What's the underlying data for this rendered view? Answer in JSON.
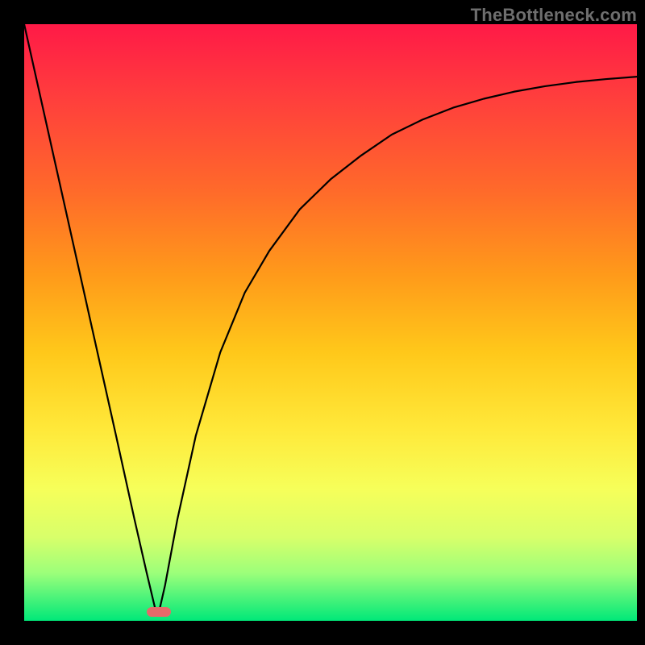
{
  "watermark": "TheBottleneck.com",
  "colors": {
    "frame": "#000000",
    "gradient_top": "#ff1a47",
    "gradient_bottom": "#00e879",
    "curve": "#000000",
    "marker": "#e56a6a",
    "watermark": "#6e6e6e"
  },
  "chart_data": {
    "type": "line",
    "title": "",
    "xlabel": "",
    "ylabel": "",
    "xlim": [
      0,
      100
    ],
    "ylim": [
      0,
      100
    ],
    "series": [
      {
        "name": "curve",
        "x": [
          0,
          5,
          10,
          15,
          18,
          20,
          21.5,
          22,
          23,
          25,
          28,
          32,
          36,
          40,
          45,
          50,
          55,
          60,
          65,
          70,
          75,
          80,
          85,
          90,
          95,
          100
        ],
        "values": [
          100,
          77,
          54,
          31,
          17,
          8,
          1.5,
          1.5,
          6,
          17,
          31,
          45,
          55,
          62,
          69,
          74,
          78,
          81.5,
          84,
          86,
          87.5,
          88.7,
          89.6,
          90.3,
          90.8,
          91.2
        ]
      }
    ],
    "marker": {
      "x": 22,
      "y": 1.5
    },
    "grid": false,
    "legend": false
  }
}
